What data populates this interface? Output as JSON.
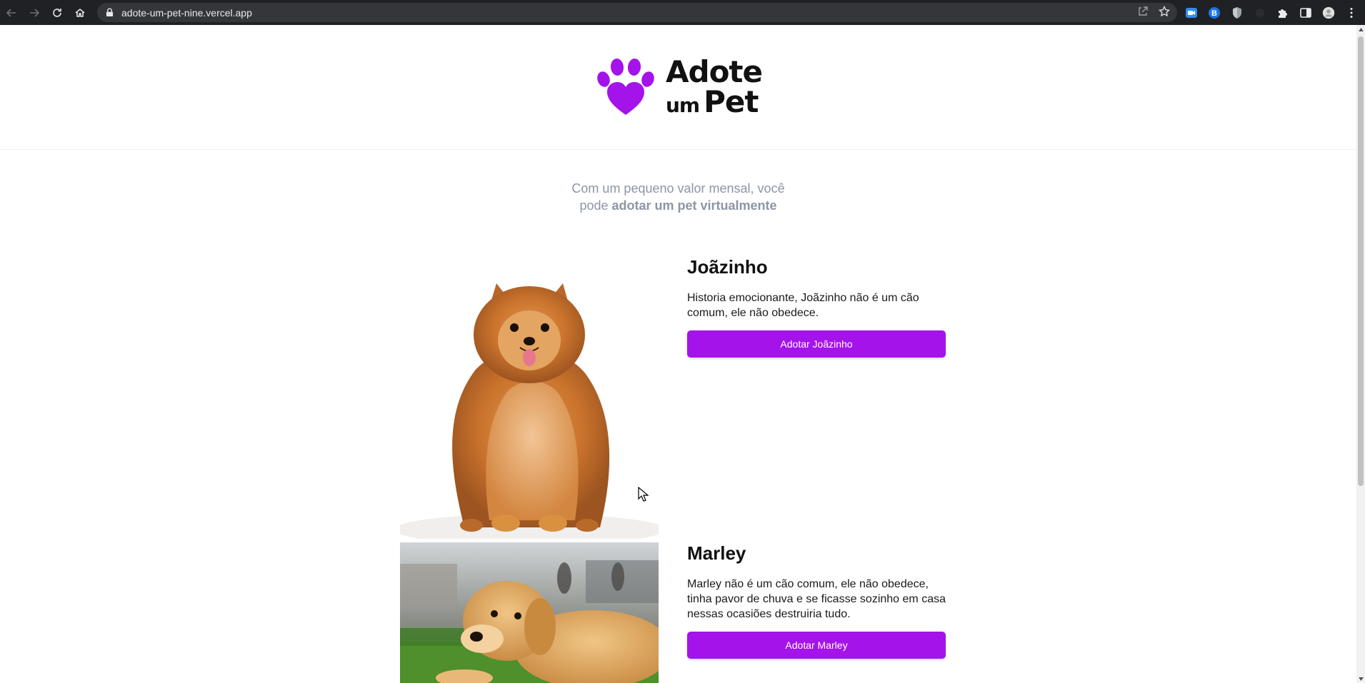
{
  "browser": {
    "url": "adote-um-pet-nine.vercel.app",
    "icons": [
      "back-icon",
      "forward-icon",
      "reload-icon",
      "home-icon",
      "lock-icon",
      "share-icon",
      "bookmark-star-icon",
      "zoom-extension-icon",
      "b-extension-icon",
      "shield-extension-icon",
      "puzzle-icon",
      "side-panel-icon",
      "profile-avatar",
      "menu-dots-icon"
    ]
  },
  "header": {
    "logo_line1": "Adote",
    "logo_um": "um",
    "logo_pet": "Pet",
    "brand_color": "#a413ea"
  },
  "intro": {
    "text_before": "Com um pequeno valor mensal, você",
    "text_line2_prefix": "pode ",
    "text_bold": "adotar um pet virtualmente"
  },
  "pets": [
    {
      "name": "Joãzinho",
      "description": "Historia emocionante, Joãzinho não é um cão comum, ele não obedece.",
      "button_label": "Adotar Joãzinho"
    },
    {
      "name": "Marley",
      "description": "Marley não é um cão comum, ele não obedece, tinha pavor de chuva e se ficasse sozinho em casa nessas ocasiões destruiria tudo.",
      "button_label": "Adotar Marley"
    }
  ],
  "colors": {
    "accent": "#a413ea",
    "subtitle": "#8d95a5",
    "chrome_bg": "#202124"
  }
}
